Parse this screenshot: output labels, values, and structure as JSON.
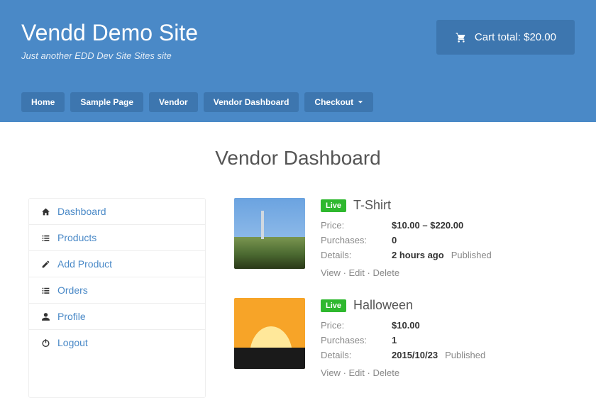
{
  "header": {
    "site_title": "Vendd Demo Site",
    "tagline": "Just another EDD Dev Site Sites site",
    "cart_label": "Cart total: $20.00"
  },
  "nav": {
    "items": [
      "Home",
      "Sample Page",
      "Vendor",
      "Vendor Dashboard",
      "Checkout"
    ]
  },
  "page_title": "Vendor Dashboard",
  "sidebar": {
    "items": [
      {
        "icon": "home",
        "label": "Dashboard"
      },
      {
        "icon": "list",
        "label": "Products"
      },
      {
        "icon": "pencil",
        "label": "Add Product"
      },
      {
        "icon": "list",
        "label": "Orders"
      },
      {
        "icon": "user",
        "label": "Profile"
      },
      {
        "icon": "power",
        "label": "Logout"
      }
    ]
  },
  "products": [
    {
      "status": "Live",
      "title": "T-Shirt",
      "price": "$10.00 – $220.00",
      "purchases": "0",
      "detail_time": "2 hours ago",
      "detail_status": "Published"
    },
    {
      "status": "Live",
      "title": "Halloween",
      "price": "$10.00",
      "purchases": "1",
      "detail_time": "2015/10/23",
      "detail_status": "Published"
    }
  ],
  "labels": {
    "price": "Price:",
    "purchases": "Purchases:",
    "details": "Details:",
    "view": "View",
    "edit": "Edit",
    "delete": "Delete"
  }
}
